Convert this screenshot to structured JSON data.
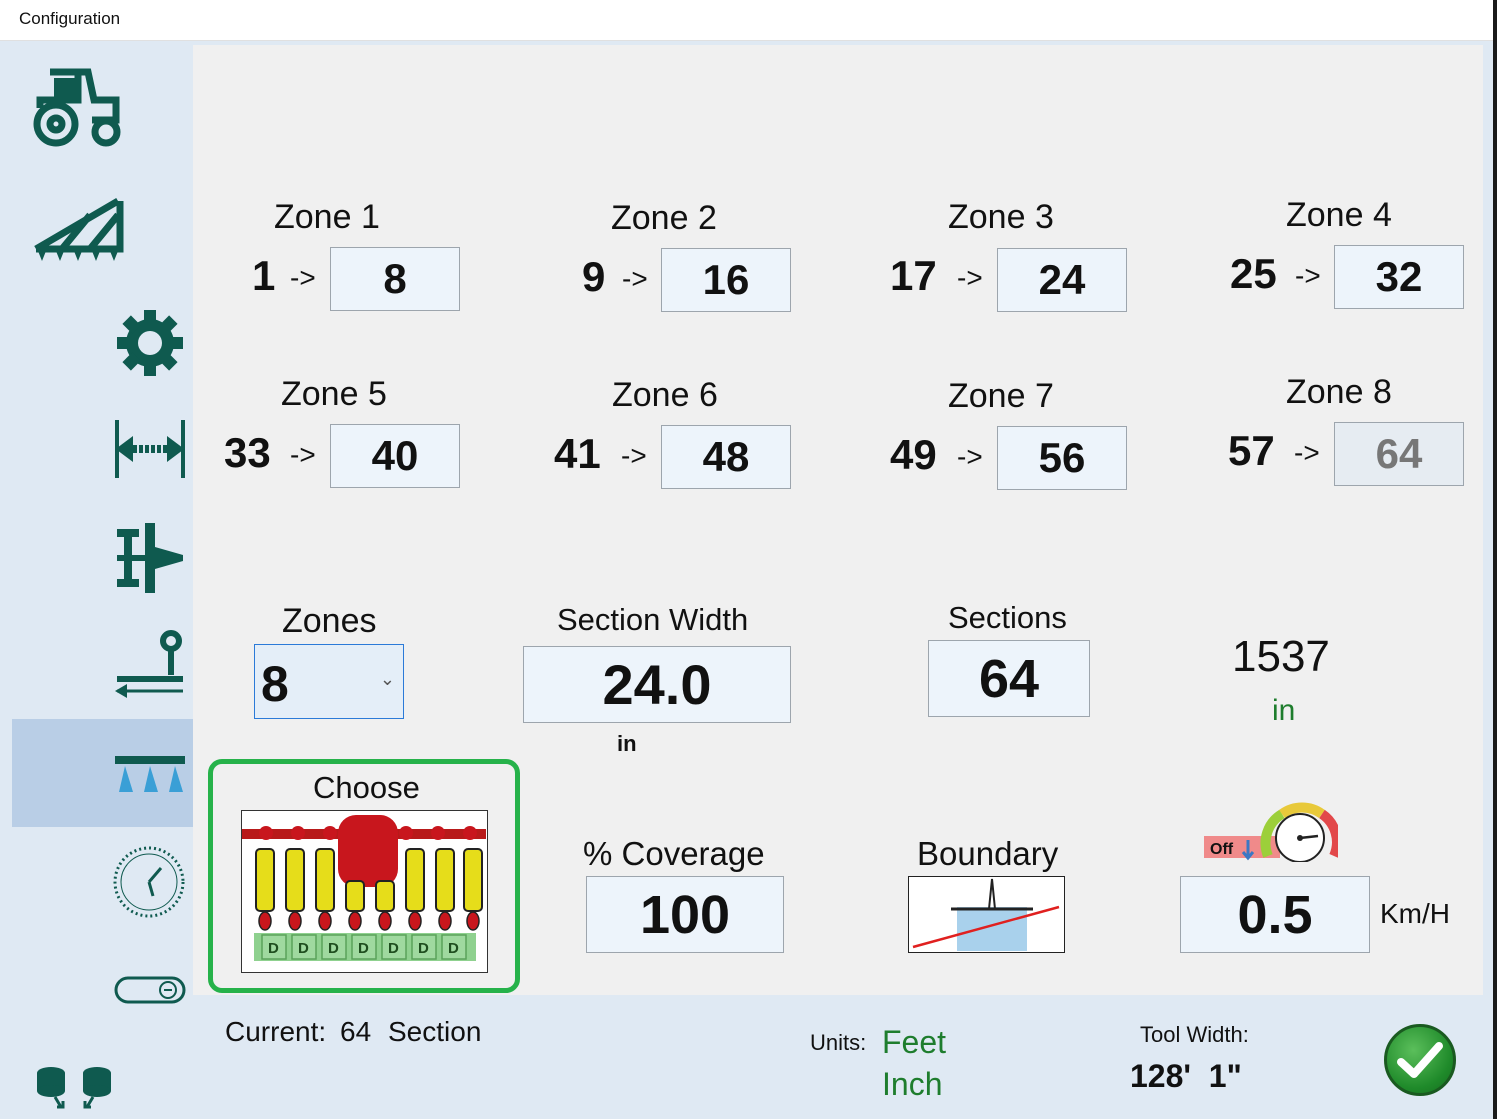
{
  "window": {
    "title": "Configuration"
  },
  "sidebar": {
    "items": [
      {
        "icon": "tractor-icon"
      },
      {
        "icon": "implement-icon"
      },
      {
        "icon": "gear-icon"
      },
      {
        "icon": "width-arrows-icon"
      },
      {
        "icon": "hitch-icon"
      },
      {
        "icon": "offset-icon"
      },
      {
        "icon": "boom-sections-icon",
        "selected": true
      },
      {
        "icon": "clock-icon"
      },
      {
        "icon": "toggle-icon"
      },
      {
        "icon": "save-load-icon"
      }
    ]
  },
  "zones": [
    {
      "title": "Zone 1",
      "start": "1",
      "arrow": "->",
      "end": "8"
    },
    {
      "title": "Zone 2",
      "start": "9",
      "arrow": "->",
      "end": "16"
    },
    {
      "title": "Zone 3",
      "start": "17",
      "arrow": "->",
      "end": "24"
    },
    {
      "title": "Zone 4",
      "start": "25",
      "arrow": "->",
      "end": "32"
    },
    {
      "title": "Zone 5",
      "start": "33",
      "arrow": "->",
      "end": "40"
    },
    {
      "title": "Zone 6",
      "start": "41",
      "arrow": "->",
      "end": "48"
    },
    {
      "title": "Zone 7",
      "start": "49",
      "arrow": "->",
      "end": "56"
    },
    {
      "title": "Zone 8",
      "start": "57",
      "arrow": "->",
      "end": "64"
    }
  ],
  "settings": {
    "zones_label": "Zones",
    "zones_value": "8",
    "section_width_label": "Section Width",
    "section_width_value": "24.0",
    "section_width_unit": "in",
    "sections_label": "Sections",
    "sections_value": "64",
    "total_width_value": "1537",
    "total_width_unit": "in",
    "choose_label": "Choose",
    "coverage_label": "% Coverage",
    "coverage_value": "100",
    "boundary_label": "Boundary",
    "speed_off_label": "Off",
    "speed_value": "0.5",
    "speed_unit": "Km/H"
  },
  "footer": {
    "current_label": "Current:",
    "current_value": "64",
    "current_suffix": "Section",
    "units_label": "Units:",
    "units_feet": "Feet",
    "units_inch": "Inch",
    "tool_width_label": "Tool Width:",
    "tool_width_value": "128'  1\""
  },
  "colors": {
    "accent_green": "#1e7d2d",
    "icon_teal": "#0f5a4f",
    "selected_nav": "#b9cee6",
    "choose_border": "#26b24a"
  }
}
